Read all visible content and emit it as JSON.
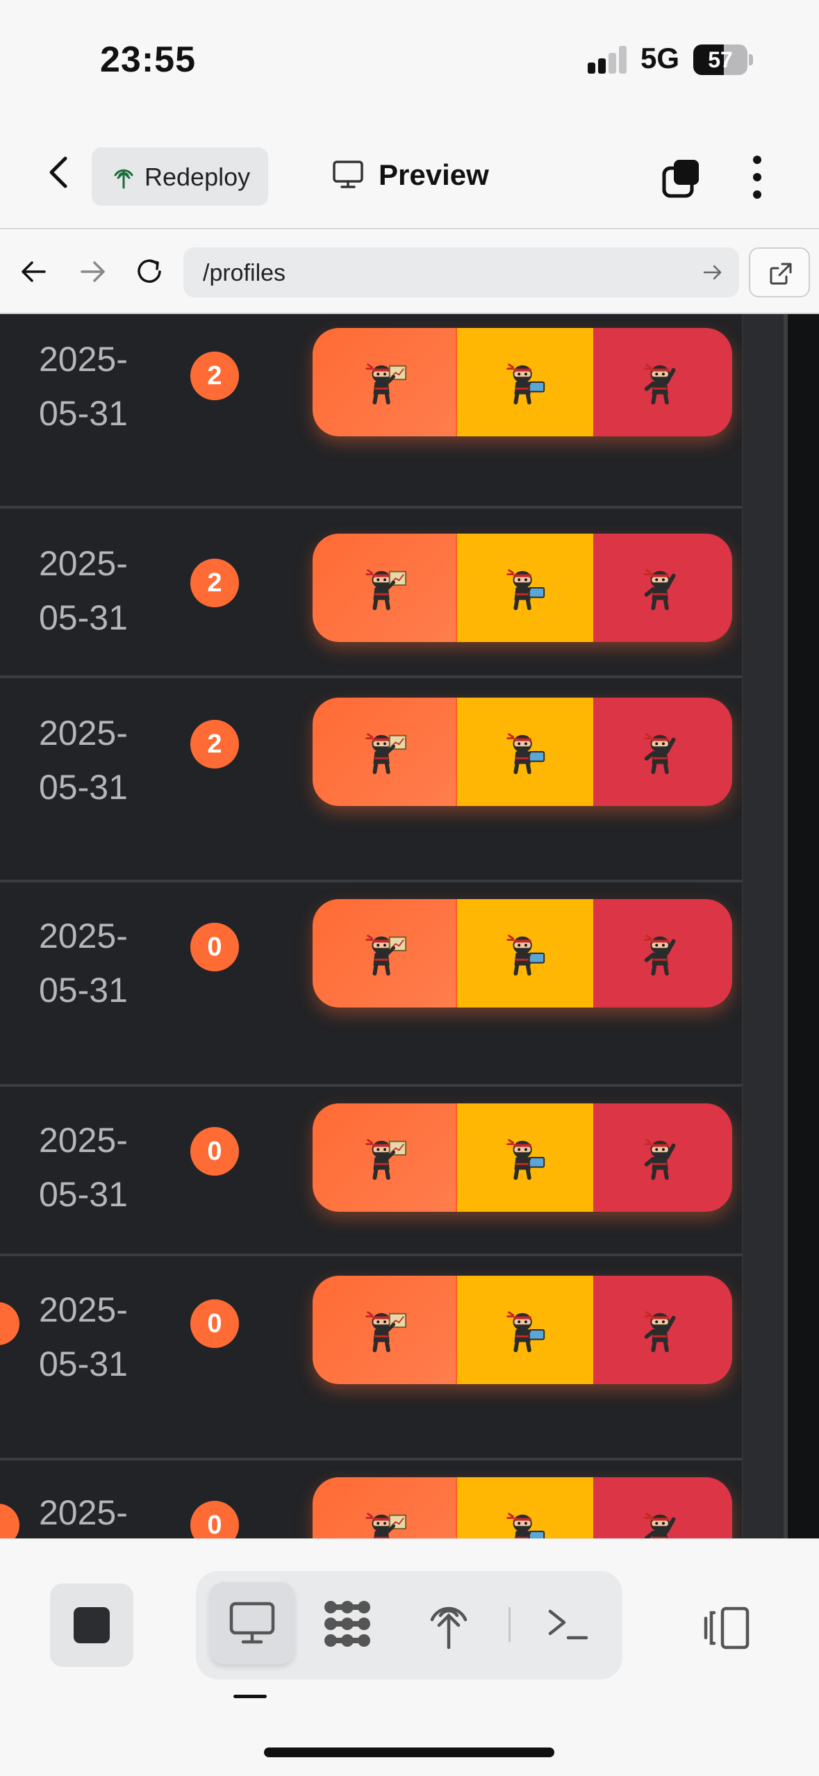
{
  "status_bar": {
    "time": "23:55",
    "network": "5G",
    "battery": "57",
    "battery_level_percent": 57,
    "signal_bars_active": 2,
    "signal_bars_total": 4
  },
  "header": {
    "redeploy_label": "Redeploy",
    "preview_label": "Preview"
  },
  "browser": {
    "url": "/profiles"
  },
  "rows": [
    {
      "date": "2025-\n05-31",
      "count": "2"
    },
    {
      "date": "2025-\n05-31",
      "count": "2"
    },
    {
      "date": "2025-\n05-31",
      "count": "2"
    },
    {
      "date": "2025-\n05-31",
      "count": "0"
    },
    {
      "date": "2025-\n05-31",
      "count": "0"
    },
    {
      "date": "2025-\n05-31",
      "count": "0"
    },
    {
      "date": "2025-",
      "count": "0"
    }
  ],
  "segment_icons": [
    "ninja-presenter-icon",
    "ninja-laptop-icon",
    "ninja-cheer-icon"
  ],
  "colors": {
    "accent": "#ff6b35",
    "yellow": "#ffb703",
    "red": "#dc3545",
    "content_bg": "#222326"
  },
  "toolbar": {
    "icons": [
      "stop-icon",
      "monitor-icon",
      "network-icon",
      "antenna-icon",
      "terminal-icon",
      "layout-toggle-icon"
    ],
    "active_tab": "monitor-icon"
  }
}
